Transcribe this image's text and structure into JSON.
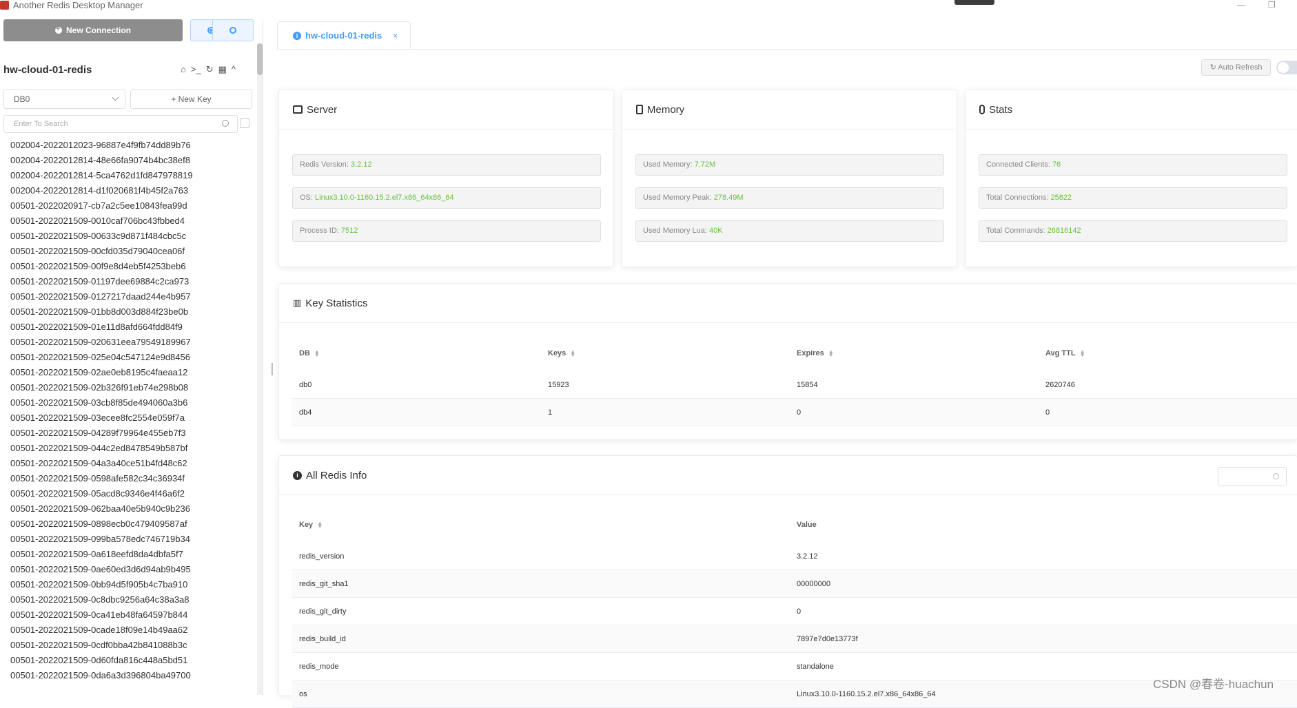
{
  "window": {
    "title": "Another Redis Desktop Manager",
    "minimize": "—",
    "restore": "❐"
  },
  "sidebar": {
    "new_connection": "New Connection",
    "connection_name": "hw-cloud-01-redis",
    "db_selected": "DB0",
    "new_key": "New Key",
    "search_placeholder": "Enter To Search",
    "keys": [
      "002004-2022012023-96887e4f9fb74dd89b76",
      "002004-2022012814-48e66fa9074b4bc38ef8",
      "002004-2022012814-5ca4762d1fd847978819",
      "002004-2022012814-d1f020681f4b45f2a763",
      "00501-2022020917-cb7a2c5ee10843fea99d",
      "00501-2022021509-0010caf706bc43fbbed4",
      "00501-2022021509-00633c9d871f484cbc5c",
      "00501-2022021509-00cfd035d79040cea06f",
      "00501-2022021509-00f9e8d4eb5f4253beb6",
      "00501-2022021509-01197dee69884c2ca973",
      "00501-2022021509-0127217daad244e4b957",
      "00501-2022021509-01bb8d003d884f23be0b",
      "00501-2022021509-01e11d8afd664fdd84f9",
      "00501-2022021509-020631eea79549189967",
      "00501-2022021509-025e04c547124e9d8456",
      "00501-2022021509-02ae0eb8195c4faeaa12",
      "00501-2022021509-02b326f91eb74e298b08",
      "00501-2022021509-03cb8f85de494060a3b6",
      "00501-2022021509-03ecee8fc2554e059f7a",
      "00501-2022021509-04289f79964e455eb7f3",
      "00501-2022021509-044c2ed8478549b587bf",
      "00501-2022021509-04a3a40ce51b4fd48c62",
      "00501-2022021509-0598afe582c34c36934f",
      "00501-2022021509-05acd8c9346e4f46a6f2",
      "00501-2022021509-062baa40e5b940c9b236",
      "00501-2022021509-0898ecb0c479409587af",
      "00501-2022021509-099ba578edc746719b34",
      "00501-2022021509-0a618eefd8da4dbfa5f7",
      "00501-2022021509-0ae60ed3d6d94ab9b495",
      "00501-2022021509-0bb94d5f905b4c7ba910",
      "00501-2022021509-0c8dbc9256a64c38a3a8",
      "00501-2022021509-0ca41eb48fa64597b844",
      "00501-2022021509-0cade18f09e14b49aa62",
      "00501-2022021509-0cdf0bba42b841088b3c",
      "00501-2022021509-0d60fda816c448a5bd51",
      "00501-2022021509-0da6a3d396804ba49700"
    ]
  },
  "tab": {
    "label": "hw-cloud-01-redis",
    "close": "×"
  },
  "auto_refresh": "Auto Refresh",
  "server": {
    "title": "Server",
    "items": [
      {
        "label": "Redis Version: ",
        "value": "3.2.12"
      },
      {
        "label": "OS: ",
        "value": "Linux3.10.0-1160.15.2.el7.x86_64x86_64"
      },
      {
        "label": "Process ID: ",
        "value": "7512"
      }
    ]
  },
  "memory": {
    "title": "Memory",
    "items": [
      {
        "label": "Used Memory: ",
        "value": "7.72M"
      },
      {
        "label": "Used Memory Peak: ",
        "value": "278.49M"
      },
      {
        "label": "Used Memory Lua: ",
        "value": "40K"
      }
    ]
  },
  "stats": {
    "title": "Stats",
    "items": [
      {
        "label": "Connected Clients: ",
        "value": "76"
      },
      {
        "label": "Total Connections: ",
        "value": "25822"
      },
      {
        "label": "Total Commands: ",
        "value": "26816142"
      }
    ]
  },
  "key_statistics": {
    "title": "Key Statistics",
    "headers": [
      "DB",
      "Keys",
      "Expires",
      "Avg TTL"
    ],
    "rows": [
      [
        "db0",
        "15923",
        "15854",
        "2620746"
      ],
      [
        "db4",
        "1",
        "0",
        "0"
      ]
    ]
  },
  "all_info": {
    "title": "All Redis Info",
    "headers": [
      "Key",
      "Value"
    ],
    "rows": [
      [
        "redis_version",
        "3.2.12"
      ],
      [
        "redis_git_sha1",
        "00000000"
      ],
      [
        "redis_git_dirty",
        "0"
      ],
      [
        "redis_build_id",
        "7897e7d0e13773f"
      ],
      [
        "redis_mode",
        "standalone"
      ],
      [
        "os",
        "Linux3.10.0-1160.15.2.el7.x86_64x86_64"
      ]
    ]
  },
  "watermark": "CSDN @春卷-huachun",
  "colors": {
    "accent": "#409eff",
    "value": "#67c23a"
  }
}
